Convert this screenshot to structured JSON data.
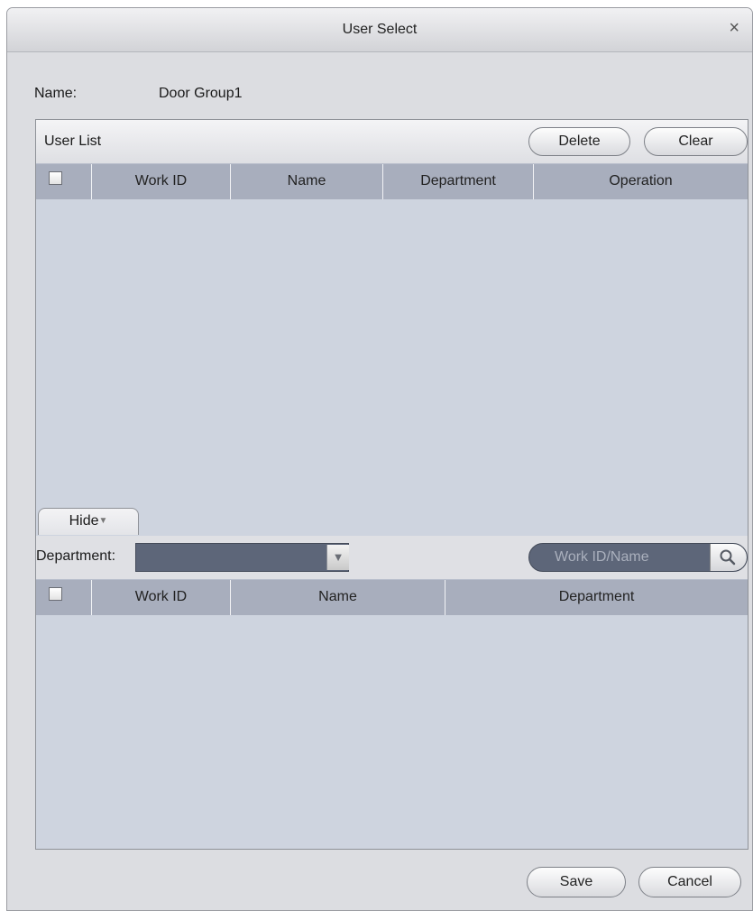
{
  "window": {
    "title": "User Select",
    "close_glyph": "×"
  },
  "form": {
    "name_label": "Name:",
    "name_value": "Door Group1"
  },
  "user_list": {
    "title": "User List",
    "delete_label": "Delete",
    "clear_label": "Clear",
    "columns": [
      "Work ID",
      "Name",
      "Department",
      "Operation"
    ]
  },
  "selector": {
    "hide_label": "Hide",
    "department_label": "Department:",
    "department_value": "",
    "search_placeholder": "Work ID/Name",
    "columns": [
      "Work ID",
      "Name",
      "Department"
    ]
  },
  "footer": {
    "save_label": "Save",
    "cancel_label": "Cancel"
  },
  "icons": {
    "close": "close-icon",
    "dropdown": "triangle-down-icon",
    "search": "magnifier-icon"
  },
  "colors": {
    "table_header": "#a8aebd",
    "table_body": "#ced4df",
    "select_bg": "#5d6679"
  }
}
